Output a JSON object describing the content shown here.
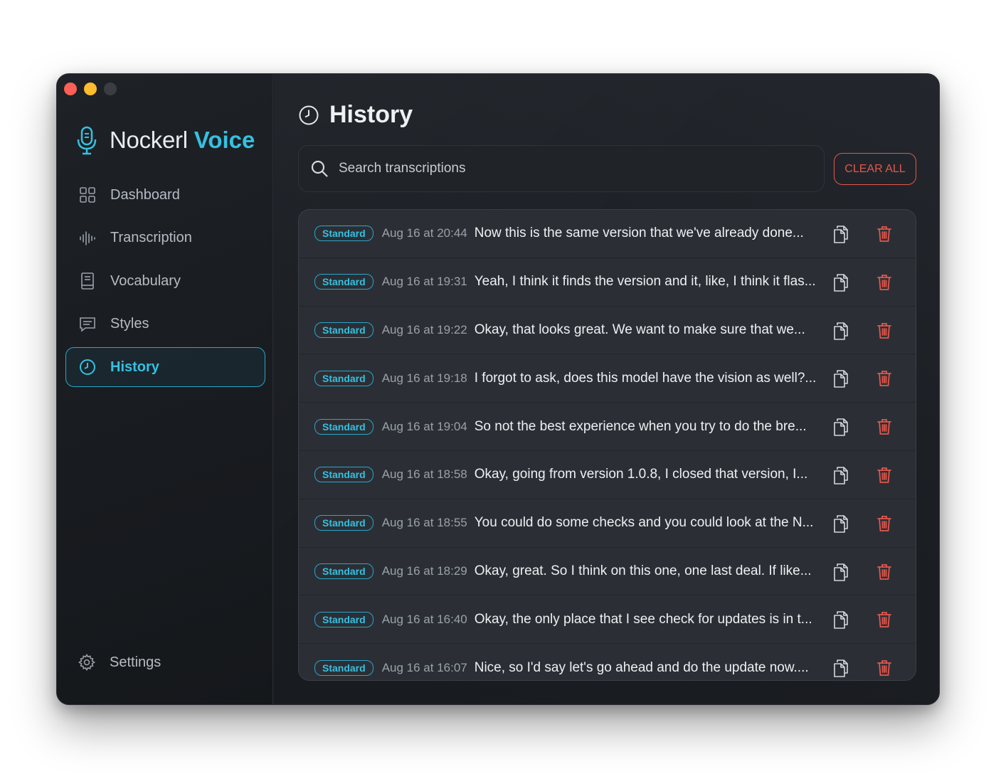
{
  "app": {
    "brand_name": "Nockerl",
    "brand_accent": "Voice",
    "accent_color": "#36c0e0",
    "danger_color": "#e2574c"
  },
  "sidebar": {
    "items": [
      {
        "label": "Dashboard",
        "icon": "grid-icon"
      },
      {
        "label": "Transcription",
        "icon": "waveform-icon"
      },
      {
        "label": "Vocabulary",
        "icon": "book-icon"
      },
      {
        "label": "Styles",
        "icon": "chat-icon"
      },
      {
        "label": "History",
        "icon": "clock-icon",
        "active": true
      }
    ],
    "settings_label": "Settings"
  },
  "main": {
    "title": "History",
    "search_placeholder": "Search transcriptions",
    "clear_all_label": "CLEAR ALL",
    "rows": [
      {
        "badge": "Standard",
        "time": "Aug 16 at 20:44",
        "text": "Now this is the same version that we've already done..."
      },
      {
        "badge": "Standard",
        "time": "Aug 16 at 19:31",
        "text": "Yeah, I think it finds the version and it, like, I think it flas..."
      },
      {
        "badge": "Standard",
        "time": "Aug 16 at 19:22",
        "text": "Okay, that looks great. We want to make sure that we..."
      },
      {
        "badge": "Standard",
        "time": "Aug 16 at 19:18",
        "text": "I forgot to ask, does this model have the vision as well?..."
      },
      {
        "badge": "Standard",
        "time": "Aug 16 at 19:04",
        "text": "So not the best experience when you try to do the bre..."
      },
      {
        "badge": "Standard",
        "time": "Aug 16 at 18:58",
        "text": "Okay, going from version 1.0.8, I closed that version, I..."
      },
      {
        "badge": "Standard",
        "time": "Aug 16 at 18:55",
        "text": "You could do some checks and you could look at the N..."
      },
      {
        "badge": "Standard",
        "time": "Aug 16 at 18:29",
        "text": "Okay, great. So I think on this one, one last deal. If like..."
      },
      {
        "badge": "Standard",
        "time": "Aug 16 at 16:40",
        "text": "Okay, the only place that I see check for updates is in t..."
      },
      {
        "badge": "Standard",
        "time": "Aug 16 at 16:07",
        "text": "Nice, so I'd say let's go ahead and do the update now...."
      }
    ]
  }
}
